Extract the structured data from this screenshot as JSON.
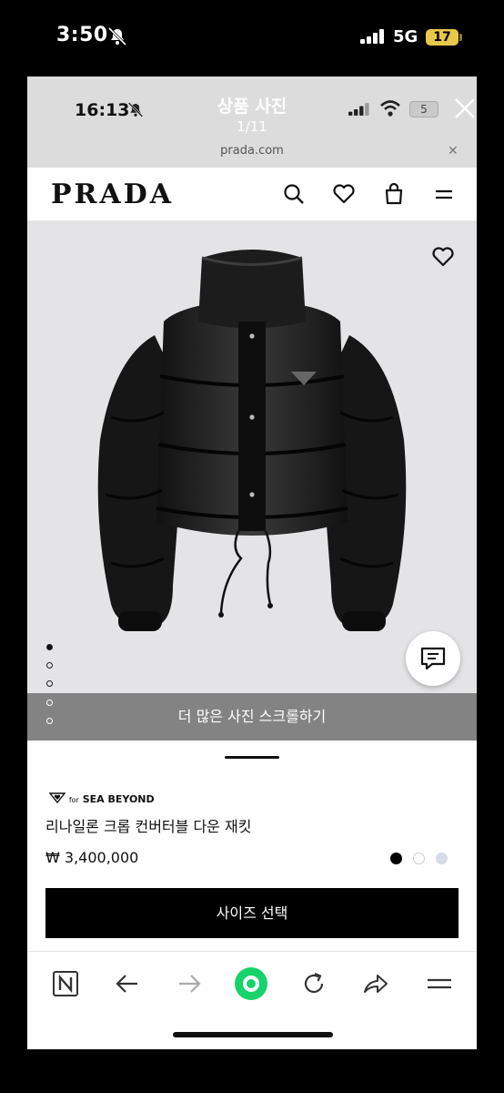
{
  "outer_status": {
    "time": "3:50",
    "network": "5G",
    "battery": "17"
  },
  "viewer": {
    "inner_time": "16:13",
    "title": "상품 사진",
    "counter": "1/11",
    "inner_battery": "5",
    "url": "prada.com"
  },
  "prada": {
    "logo": "PRADA"
  },
  "gallery": {
    "more_photos": "더 많은 사진 스크롤하기",
    "active_dot": 0
  },
  "product": {
    "badge_small": "for",
    "badge_brand": "SEA BEYOND",
    "name": "리나일론 크롭 컨버터블 다운 재킷",
    "price": "₩ 3,400,000",
    "swatches": [
      "#000000",
      "#ffffff",
      "#d6dbe6"
    ],
    "size_button": "사이즈 선택"
  },
  "icons": {
    "header": [
      "search-icon",
      "heart-icon",
      "bag-icon",
      "menu-icon"
    ],
    "toolbar": [
      "naver-icon",
      "back-arrow-icon",
      "forward-arrow-icon",
      "green-home-icon",
      "reload-icon",
      "share-icon",
      "menu-icon"
    ]
  }
}
